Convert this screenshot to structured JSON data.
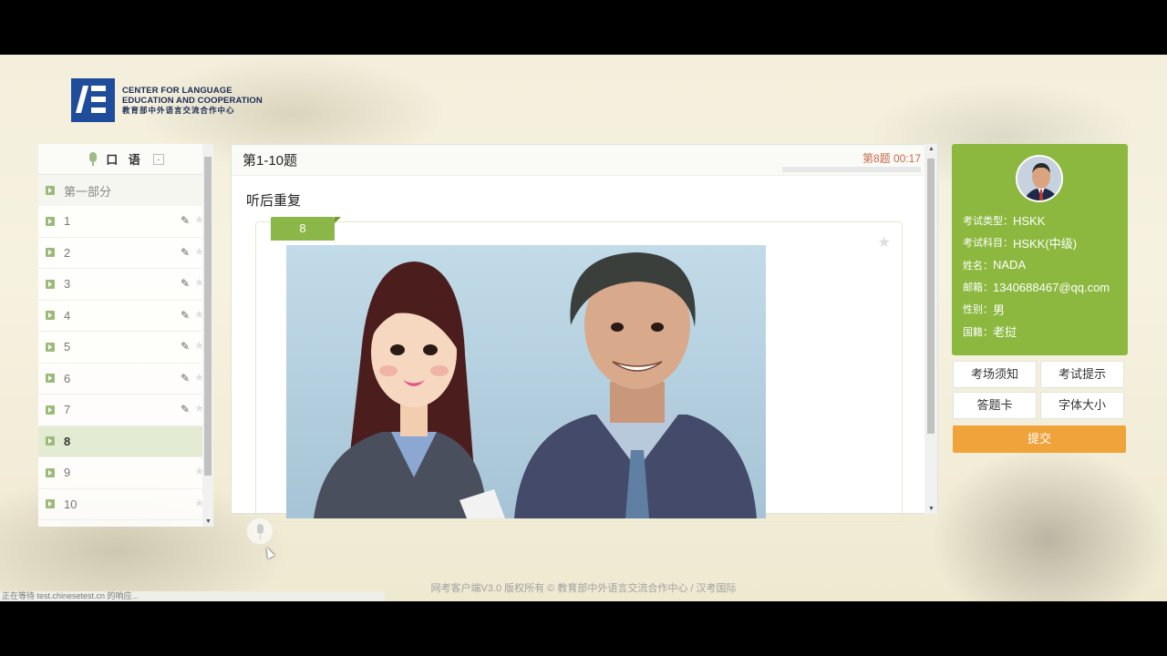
{
  "logo": {
    "line1": "CENTER FOR LANGUAGE",
    "line2": "EDUCATION AND COOPERATION",
    "line3": "教育部中外语言交流合作中心"
  },
  "left_panel": {
    "title": "口 语",
    "collapse": "-",
    "section": "第一部分",
    "items": [
      {
        "label": "1",
        "pencil": "✎",
        "star": "★"
      },
      {
        "label": "2",
        "pencil": "✎",
        "star": "★"
      },
      {
        "label": "3",
        "pencil": "✎",
        "star": "★"
      },
      {
        "label": "4",
        "pencil": "✎",
        "star": "★"
      },
      {
        "label": "5",
        "pencil": "✎",
        "star": "★"
      },
      {
        "label": "6",
        "pencil": "✎",
        "star": "★"
      },
      {
        "label": "7",
        "pencil": "✎",
        "star": "★"
      },
      {
        "label": "8",
        "pencil": "",
        "star": ""
      },
      {
        "label": "9",
        "pencil": "",
        "star": "★"
      },
      {
        "label": "10",
        "pencil": "",
        "star": "★"
      }
    ],
    "active_index": 7
  },
  "main": {
    "title": "第1-10题",
    "timer": "第8题 00:17",
    "progress_fraction": 0.0,
    "section_label": "听后重复",
    "question_number": "8",
    "star": "★"
  },
  "profile": {
    "rows": [
      {
        "key": "考试类型：",
        "val": "HSKK"
      },
      {
        "key": "考试科目：",
        "val": "HSKK(中级)"
      },
      {
        "key": "姓名：",
        "val": "NADA"
      },
      {
        "key": "邮箱：",
        "val": "1340688467@qq.com"
      },
      {
        "key": "性别：",
        "val": "男"
      },
      {
        "key": "国籍：",
        "val": "老挝"
      }
    ]
  },
  "buttons": {
    "exam_notice": "考场须知",
    "exam_hint": "考试提示",
    "answer_sheet": "答题卡",
    "font_size": "字体大小",
    "submit": "提交"
  },
  "footer": "网考客户端V3.0 版权所有 © 教育部中外语言交流合作中心 / 汉考国际",
  "status_bar": "正在等待 test.chinesetest.cn 的响应..."
}
